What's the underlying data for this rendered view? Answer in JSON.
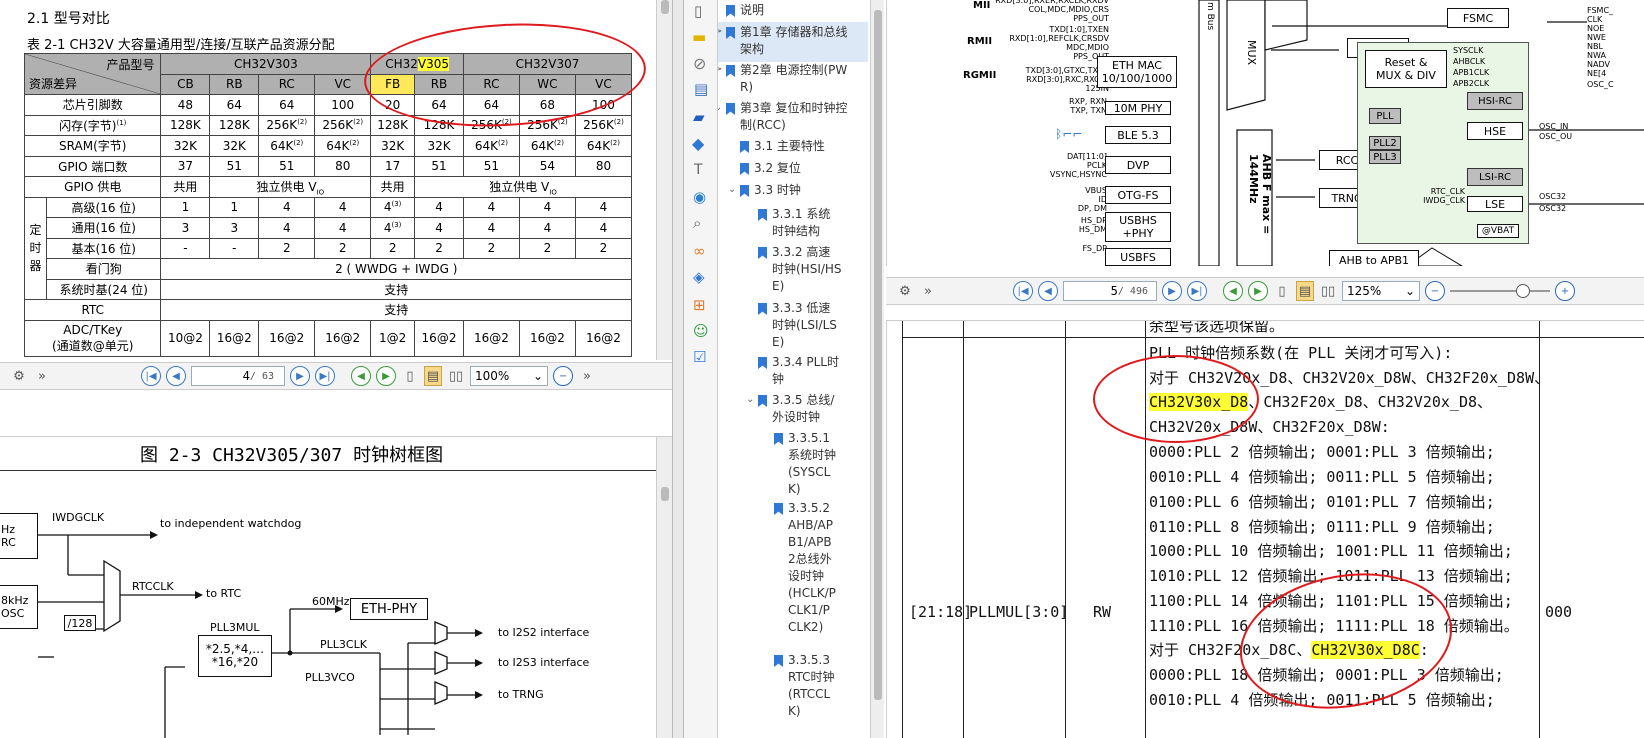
{
  "left_top": {
    "heading": "2.1 型号对比",
    "table_caption": "表 2-1 CH32V 大容量通用型/连接/互联产品资源分配",
    "hdr_model": "产品型号",
    "hdr_diff": "资源差异",
    "groups": [
      "CH32V303",
      "CH32V305",
      "CH32V307"
    ],
    "v305_prefix": "CH32",
    "v305_hl": "V305",
    "subcols": [
      "CB",
      "RB",
      "RC",
      "VC",
      "FB",
      "RB",
      "RC",
      "WC",
      "VC"
    ],
    "rows": [
      {
        "label": "芯片引脚数",
        "cells": [
          "48",
          "64",
          "64",
          "100",
          "20",
          "64",
          "64",
          "68",
          "100"
        ]
      },
      {
        "label": "闪存(字节)",
        "sup": "(1)",
        "cells": [
          "128K",
          "128K",
          "256K",
          "256K",
          "128K",
          "128K",
          "256K",
          "256K",
          "256K"
        ]
      },
      {
        "label": "SRAM(字节)",
        "cells": [
          "32K",
          "32K",
          "64K",
          "64K",
          "32K",
          "32K",
          "64K",
          "64K",
          "64K"
        ]
      },
      {
        "label": "GPIO 端口数",
        "cells": [
          "37",
          "51",
          "51",
          "80",
          "17",
          "51",
          "51",
          "54",
          "80"
        ]
      }
    ],
    "gpio_supply": {
      "label": "GPIO 供电",
      "a": "共用",
      "b": "独立供电 V",
      "b_sub": "IO",
      "c": "共用",
      "d": "独立供电 V",
      "d_sub": "IO"
    },
    "timer_group": "定时器",
    "timer_rows": [
      {
        "label": "高级(16 位)",
        "cells": [
          "1",
          "1",
          "4",
          "4",
          "4",
          "4",
          "4",
          "4",
          "4"
        ]
      },
      {
        "label": "通用(16 位)",
        "cells": [
          "3",
          "3",
          "4",
          "4",
          "4",
          "4",
          "4",
          "4",
          "4"
        ]
      },
      {
        "label": "基本(16 位)",
        "cells": [
          "-",
          "-",
          "2",
          "2",
          "2",
          "2",
          "2",
          "2",
          "2"
        ]
      }
    ],
    "watchdog": {
      "label": "看门狗",
      "value": "2 ( WWDG + IWDG )"
    },
    "systick": {
      "label": "系统时基(24 位)",
      "value": "支持"
    },
    "rtc": {
      "label": "RTC",
      "value": "支持"
    },
    "adc": {
      "label": "ADC/TKey",
      "label2": "(通道数@单元)",
      "cells": [
        "10@2",
        "16@2",
        "16@2",
        "16@2",
        "1@2",
        "16@2",
        "16@2",
        "16@2",
        "16@2"
      ]
    },
    "sup2": "(2)",
    "sup3": "(3)",
    "toolbar": {
      "page": "4",
      "total": "/ 63",
      "zoom": "100%"
    }
  },
  "left_bottom": {
    "title": "图 2-3 CH32V305/307 时钟树框图",
    "labels": {
      "hz_rc_1": "Hz",
      "hz_rc_2": "RC",
      "khz_1": "8kHz",
      "khz_2": "OSC",
      "iwdgclk": "IWDGCLK",
      "to_wdg": "to independent watchdog",
      "rtcclk": "RTCCLK",
      "to_rtc": "to RTC",
      "div128": "/128",
      "mhz60": "60MHz",
      "ethphy": "ETH-PHY",
      "pll3mul": "PLL3MUL",
      "mul_1": "*2.5,*4,…",
      "mul_2": "*16,*20",
      "pll3clk": "PLL3CLK",
      "pll3vco": "PLL3VCO",
      "to_i2s2": "to I2S2 interface",
      "to_i2s3": "to I2S3 interface",
      "to_trng": "to TRNG"
    }
  },
  "bookmarks": {
    "items": [
      {
        "text": "说明"
      },
      {
        "text": "第1章 存储器和总线架构"
      },
      {
        "text": "第2章 电源控制(PWR)"
      },
      {
        "text": "第3章 复位和时钟控制(RCC)"
      },
      {
        "text": "3.1 主要特性"
      },
      {
        "text": "3.2 复位"
      },
      {
        "text": "3.3 时钟"
      },
      {
        "text": "3.3.1 系统时钟结构"
      },
      {
        "text": "3.3.2 高速时钟(HSI/HSE)"
      },
      {
        "text": "3.3.3 低速时钟(LSI/LSE)"
      },
      {
        "text": "3.3.4 PLL时钟"
      },
      {
        "text": "3.3.5 总线/外设时钟"
      },
      {
        "text": "3.3.5.1 系统时钟(SYSCLK)"
      },
      {
        "text": "3.3.5.2 AHB/APB1/APB2总线外设时钟(HCLK/PCLK1/PCLK2)"
      },
      {
        "text": "3.3.5.3 RTC时钟(RTCCLK)"
      }
    ]
  },
  "right_top": {
    "labels": {
      "mii": "MII",
      "rmii": "RMII",
      "rgmii": "RGMII",
      "mii_sig": "RXD[3:0],RXER,RXCLK,RXDV\nCOL,MDC,MDIO,CRS\nPPS_OUT",
      "rmii_sig": "TXD[1:0],TXEN\nRXD[1:0],REFCLK,CRSDV\nMDC,MDIO\nPPS_OUT",
      "rgmii_sig": "TXD[3:0],GTXC,TXEN\nRXD[3:0],RXC,RXCTL\n125IN",
      "rxp": "RXP, RXN\nTXP, TXN",
      "dat": "DAT[11:0]\nPCLK\nVSYNC,HSYNC",
      "vbus": "VBUS\nID\nDP, DM",
      "hsdp": "HS_DP\nHS_DM",
      "fsdp": "FS_DP",
      "ethmac_1": "ETH MAC",
      "ethmac_2": "10/100/1000",
      "phy10m": "10M PHY",
      "ble": "BLE 5.3",
      "dvp": "DVP",
      "otgfs": "OTG-FS",
      "usbhs_1": "USBHS",
      "usbhs_2": "+PHY",
      "usbfs": "USBFS",
      "mbus": "m Bus",
      "mux": "MUX",
      "sram": "SRAM",
      "fsmc": "FSMC",
      "rcc": "RCC",
      "trng": "TRNG",
      "ahb": "AHB F max = 144MHz",
      "ahb_apb1": "AHB to APB1",
      "reset_1": "Reset &",
      "reset_2": "MUX & DIV",
      "sysclk": "SYSCLK",
      "ahbclk": "AHBCLK",
      "apb1clk": "APB1CLK",
      "apb2clk": "APB2CLK",
      "pll": "PLL",
      "pll2": "PLL2",
      "pll3": "PLL3",
      "hsirc": "HSI-RC",
      "hse": "HSE",
      "lsirc": "LSI-RC",
      "lse": "LSE",
      "rtc_clk": "RTC_CLK\nIWDG_CLK",
      "vbat": "@VBAT",
      "osc_in": "OSC_IN",
      "osc_out": "OSC_OU",
      "osc32a": "OSC32",
      "osc32b": "OSC32",
      "fsmc_sig": "FSMC_\nCLK\nNOE\nNWE\nNBL\nNWA\nNADV\nNE[4",
      "oscclk": "OSC_C"
    },
    "toolbar": {
      "page": "5",
      "total": "/ 496",
      "zoom": "125%"
    }
  },
  "right_bottom": {
    "prev_line": "余型号该选项保留。",
    "bits": "[21:18]",
    "field": "PLLMUL[3:0]",
    "access": "RW",
    "reset": "000",
    "lines": [
      "PLL 时钟倍频系数(在 PLL 关闭才可写入):",
      "对于 CH32V20x_D8、CH32V20x_D8W、CH32F20x_D8W、",
      "",
      "CH32V20x_D8W、CH32F20x_D8W:",
      "0000:PLL 2 倍频输出;   0001:PLL 3 倍频输出;",
      "0010:PLL 4 倍频输出;   0011:PLL 5 倍频输出;",
      "0100:PLL 6 倍频输出;   0101:PLL 7 倍频输出;",
      "0110:PLL 8 倍频输出;   0111:PLL 9 倍频输出;",
      "1000:PLL 10 倍频输出;  1001:PLL 11 倍频输出;",
      "1010:PLL 12 倍频输出;  1011:PLL 13 倍频输出;",
      "1100:PLL 14 倍频输出;  1101:PLL 15 倍频输出;",
      "1110:PLL 16 倍频输出;  1111:PLL 18 倍频输出。",
      "",
      "0000:PLL 18 倍频输出;  0001:PLL 3 倍频输出;",
      "0010:PLL 4 倍频输出;   0011:PLL 5 倍频输出;"
    ],
    "line3_hl": "CH32V30x_D8",
    "line3_rest": "、CH32F20x_D8、CH32V20x_D8、",
    "line13_pre": "对于 CH32F20x_D8C、",
    "line13_hl": "CH32V30x_D8C",
    "line13_post": ":"
  },
  "colors": {
    "highlight": "#ffff33",
    "annotation": "#e0191d",
    "bookmark_icon": "#2f78d6"
  }
}
